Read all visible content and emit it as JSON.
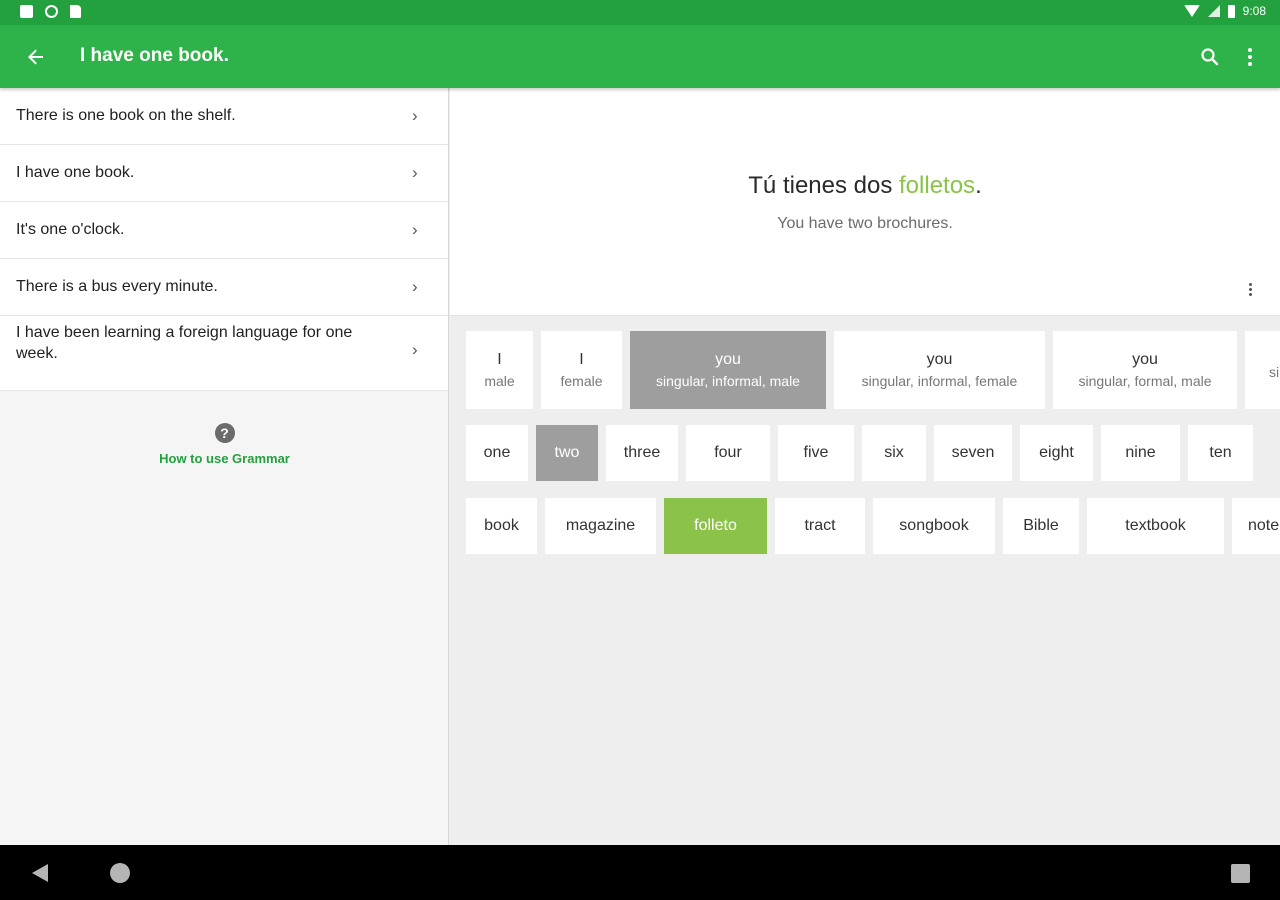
{
  "status_bar": {
    "time": "9:08"
  },
  "app_bar": {
    "title": "I have one book."
  },
  "sentences": [
    {
      "text": "There is one book on the shelf."
    },
    {
      "text": "I have one book."
    },
    {
      "text": "It's one o'clock."
    },
    {
      "text": "There is a bus every minute."
    },
    {
      "text": "I have been learning a foreign language for one week."
    }
  ],
  "help": {
    "icon_glyph": "?",
    "link": "How to use Grammar"
  },
  "preview": {
    "sentence_prefix": "Tú tienes dos ",
    "sentence_highlight": "folletos",
    "sentence_suffix": ".",
    "translation": "You have two brochures.",
    "highlight_color": "#8bc34a"
  },
  "subjects": [
    {
      "main": "I",
      "sub": "male",
      "selected": false
    },
    {
      "main": "I",
      "sub": "female",
      "selected": false
    },
    {
      "main": "you",
      "sub": "singular, informal, male",
      "selected": true
    },
    {
      "main": "you",
      "sub": "singular, informal, female",
      "selected": false
    },
    {
      "main": "you",
      "sub": "singular, formal, male",
      "selected": false
    },
    {
      "main": "",
      "sub": "sin",
      "selected": false
    }
  ],
  "numbers": [
    {
      "label": "one",
      "selected": false
    },
    {
      "label": "two",
      "selected": true
    },
    {
      "label": "three",
      "selected": false
    },
    {
      "label": "four",
      "selected": false
    },
    {
      "label": "five",
      "selected": false
    },
    {
      "label": "six",
      "selected": false
    },
    {
      "label": "seven",
      "selected": false
    },
    {
      "label": "eight",
      "selected": false
    },
    {
      "label": "nine",
      "selected": false
    },
    {
      "label": "ten",
      "selected": false
    }
  ],
  "nouns": [
    {
      "label": "book",
      "selected": false
    },
    {
      "label": "magazine",
      "selected": false
    },
    {
      "label": "folleto",
      "selected": true
    },
    {
      "label": "tract",
      "selected": false
    },
    {
      "label": "songbook",
      "selected": false
    },
    {
      "label": "Bible",
      "selected": false
    },
    {
      "label": "textbook",
      "selected": false
    },
    {
      "label": "note",
      "selected": false
    }
  ],
  "colors": {
    "primary": "#2db34a",
    "status_bar": "#23a13f",
    "accent": "#8bc34a",
    "selected_gray": "#9e9e9e"
  }
}
